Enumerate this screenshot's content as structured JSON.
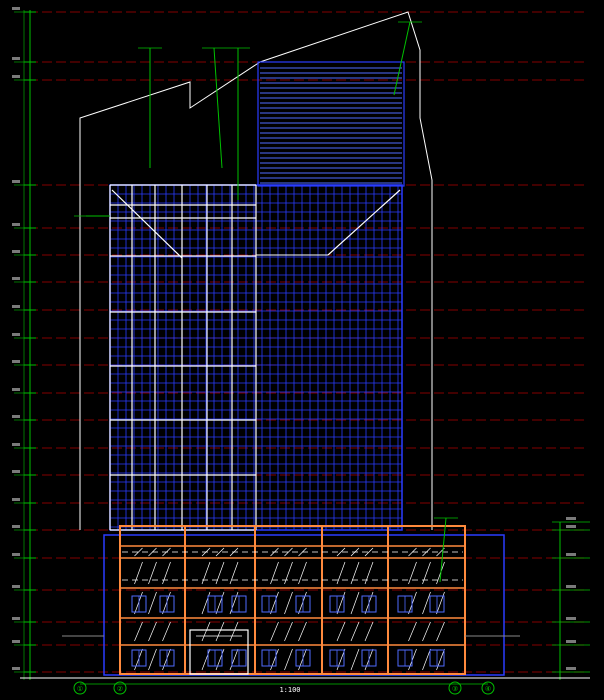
{
  "colors": {
    "background": "#000000",
    "outline": "#ffffff",
    "curtain_wall": "#2a3cff",
    "curtain_wall_light": "#4f6bff",
    "level_line": "#b00000",
    "dimension": "#00c000",
    "podium_frame": "#ff8a3d",
    "glass_hatch": "#ffffff"
  },
  "drawing": {
    "bottom_dimension": "1:100",
    "grid_bubbles": [
      "①",
      "②",
      "③",
      "④"
    ]
  },
  "annotations": [
    "—",
    "—",
    "—",
    "—",
    "—",
    "—"
  ],
  "left_elevations": [
    "",
    "",
    "",
    "",
    "",
    "",
    "",
    "",
    "",
    "",
    "",
    "",
    "",
    "",
    "",
    "",
    ""
  ],
  "right_elevations": [
    "",
    "",
    "",
    "",
    "",
    ""
  ]
}
